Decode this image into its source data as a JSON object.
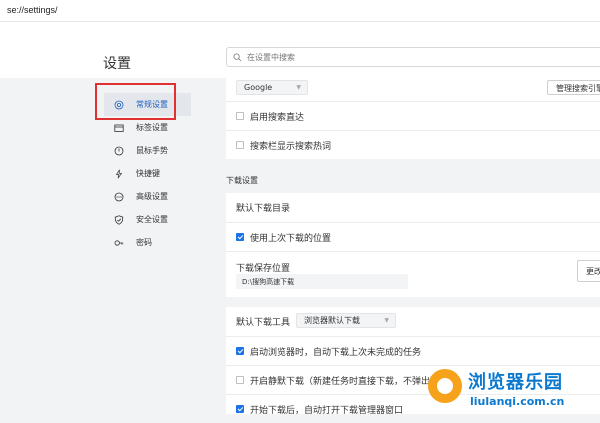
{
  "address_bar": {
    "url": "se://settings/"
  },
  "page": {
    "title": "设置"
  },
  "search": {
    "placeholder": "在设置中搜索"
  },
  "sidebar": {
    "items": [
      {
        "label": "常规设置",
        "icon": "settings-gear-icon",
        "active": true
      },
      {
        "label": "标签设置",
        "icon": "tab-icon"
      },
      {
        "label": "鼠标手势",
        "icon": "mouse-icon"
      },
      {
        "label": "快捷键",
        "icon": "lightning-icon"
      },
      {
        "label": "高级设置",
        "icon": "more-dots-icon"
      },
      {
        "label": "安全设置",
        "icon": "shield-icon"
      },
      {
        "label": "密码",
        "icon": "key-icon"
      }
    ]
  },
  "search_engine": {
    "selected": "Google",
    "manage_button": "管理搜索引擎",
    "options": [
      {
        "label": "启用搜索直达",
        "checked": false
      },
      {
        "label": "搜索栏显示搜索热词",
        "checked": false
      }
    ]
  },
  "download": {
    "section_title": "下载设置",
    "default_dir_label": "默认下载目录",
    "use_last_location": {
      "label": "使用上次下载的位置",
      "checked": true
    },
    "save_location_label": "下载保存位置",
    "save_path": "D:\\搜狗高速下载",
    "change_button": "更改",
    "default_tool_label": "默认下载工具",
    "default_tool_value": "浏览器默认下载",
    "options": [
      {
        "label": "启动浏览器时，自动下载上次未完成的任务",
        "checked": true
      },
      {
        "label": "开启静默下载（新建任务时直接下载，不弹出确认框）",
        "checked": false
      },
      {
        "label": "开始下载后，自动打开下载管理器窗口",
        "checked": true
      }
    ]
  },
  "watermark": {
    "name": "浏览器乐园",
    "url": "liulanqi.com.cn"
  },
  "colors": {
    "accent": "#1a73e8",
    "highlight": "#e03030",
    "watermark": "#0b79cf"
  }
}
